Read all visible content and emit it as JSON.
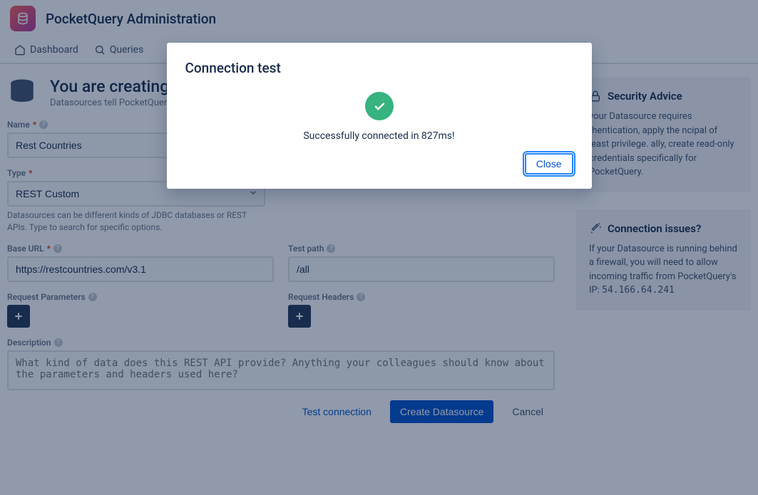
{
  "header": {
    "title": "PocketQuery Administration"
  },
  "tabs": [
    {
      "label": "Dashboard"
    },
    {
      "label": "Queries"
    }
  ],
  "page": {
    "title": "You are creating",
    "subtitle": "Datasources tell PocketQuery"
  },
  "form": {
    "name": {
      "label": "Name",
      "value": "Rest Countries"
    },
    "type": {
      "label": "Type",
      "value": "REST Custom",
      "hint": "Datasources can be different kinds of JDBC databases or REST APIs. Type to search for specific options."
    },
    "baseUrl": {
      "label": "Base URL",
      "value": "https://restcountries.com/v3.1"
    },
    "testPath": {
      "label": "Test path",
      "value": "/all"
    },
    "reqParams": {
      "label": "Request Parameters"
    },
    "reqHeaders": {
      "label": "Request Headers"
    },
    "description": {
      "label": "Description",
      "placeholder": "What kind of data does this REST API provide? Anything your colleagues should know about the parameters and headers used here?"
    }
  },
  "actions": {
    "test": "Test connection",
    "create": "Create Datasource",
    "cancel": "Cancel"
  },
  "sidepanels": {
    "security": {
      "title": "Security Advice",
      "text": "your Datasource requires thentication, apply the ncipal of least privilege. ally, create read-only credentials specifically for PocketQuery."
    },
    "conn": {
      "title": "Connection issues?",
      "text": "If your Datasource is running behind a firewall, you will need to allow incoming traffic from PocketQuery's IP:",
      "ip": "54.166.64.241"
    }
  },
  "modal": {
    "title": "Connection test",
    "message": "Successfully connected in 827ms!",
    "close": "Close"
  }
}
